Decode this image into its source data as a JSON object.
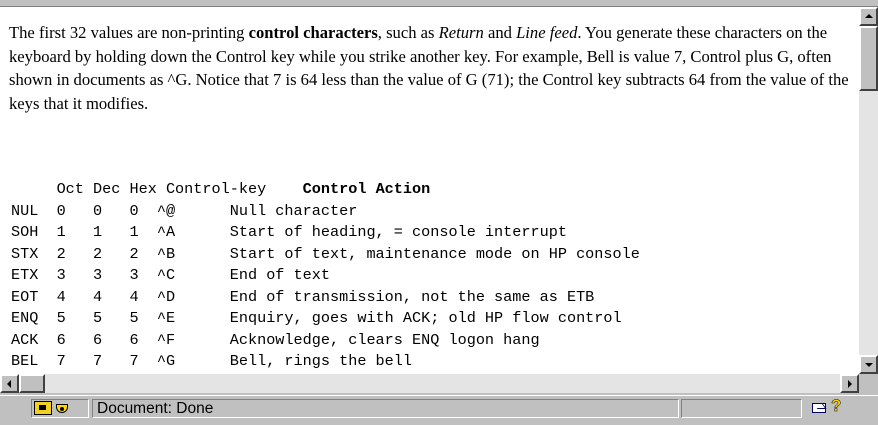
{
  "intro": {
    "s1_before": "The first 32 values are non-printing ",
    "s1_bold": "control characters",
    "s1_mid": ", such as ",
    "s1_return": "Return",
    "s1_and": " and ",
    "s1_linefeed": "Line feed",
    "s1_after": ". You generate these characters on the keyboard by holding down the Control key while you strike another key. For example, Bell is value 7, Control plus G, often shown in documents as ^G. Notice that 7 is 64 less than the value of G (71); the Control key subtracts 64 from the value of the keys that it modifies."
  },
  "table": {
    "header_plain": "     Oct Dec Hex Control-key    ",
    "header_bold": "Control Action",
    "rows": [
      "NUL  0   0   0  ^@      Null character",
      "SOH  1   1   1  ^A      Start of heading, = console interrupt",
      "STX  2   2   2  ^B      Start of text, maintenance mode on HP console",
      "ETX  3   3   3  ^C      End of text",
      "EOT  4   4   4  ^D      End of transmission, not the same as ETB",
      "ENQ  5   5   5  ^E      Enquiry, goes with ACK; old HP flow control",
      "ACK  6   6   6  ^F      Acknowledge, clears ENQ logon hang",
      "BEL  7   7   7  ^G      Bell, rings the bell"
    ]
  },
  "statusbar": {
    "text": "Document: Done"
  },
  "icons": {
    "security": "security-icon",
    "online": "online-status-icon",
    "mail": "mail-icon",
    "help": "help-icon",
    "help_glyph": "?"
  }
}
